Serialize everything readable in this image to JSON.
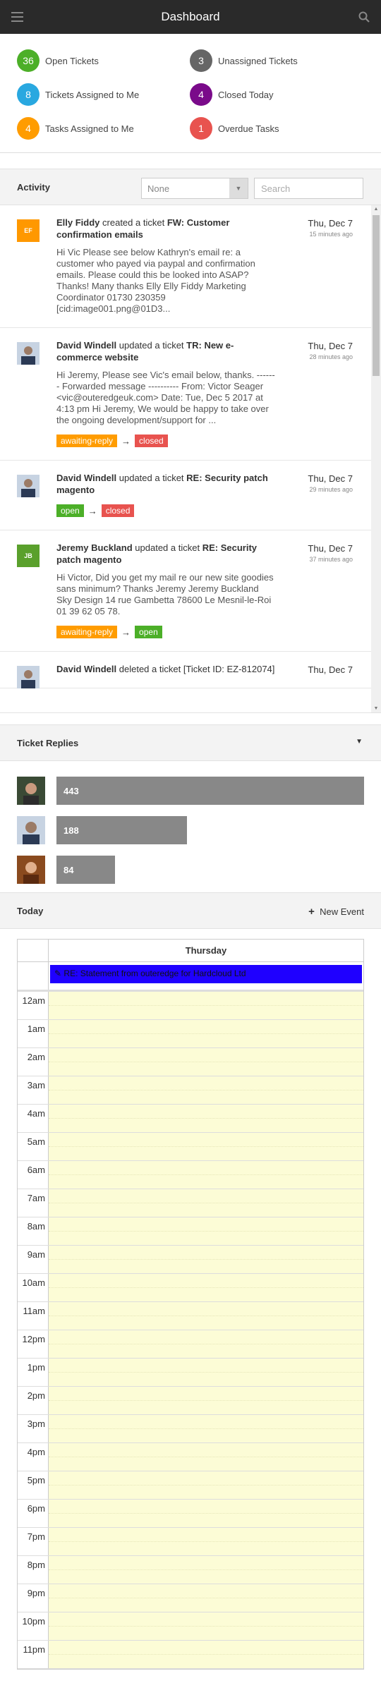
{
  "header": {
    "title": "Dashboard",
    "menu_icon": "hamburger-icon",
    "search_icon": "search-icon"
  },
  "stats": [
    {
      "count": "36",
      "label": "Open Tickets",
      "color": "#4caf28"
    },
    {
      "count": "3",
      "label": "Unassigned Tickets",
      "color": "#666666"
    },
    {
      "count": "8",
      "label": "Tickets Assigned to Me",
      "color": "#29a8e0"
    },
    {
      "count": "4",
      "label": "Closed Today",
      "color": "#7a0a8a"
    },
    {
      "count": "4",
      "label": "Tasks Assigned to Me",
      "color": "#ff9c00"
    },
    {
      "count": "1",
      "label": "Overdue Tasks",
      "color": "#e8534f"
    }
  ],
  "activity": {
    "title": "Activity",
    "filter_value": "None",
    "search_placeholder": "Search",
    "items": [
      {
        "initials": "EF",
        "avatar_color": "#ff9800",
        "actor": "Elly Fiddy",
        "action": "created a ticket",
        "subject": "FW: Customer confirmation emails",
        "date": "Thu, Dec 7",
        "ago": "15 minutes ago",
        "body": "Hi Vic    Please see below Kathryn's email re: a customer who payed via paypal and confirmation emails. Please could this be looked into ASAP? Thanks!    Many thanks  Elly    Elly Fiddy  Marketing Coordinator  01730 230359 [cid:image001.png@01D3..."
      },
      {
        "initials": "",
        "avatar_color": "#6d86a8",
        "actor": "David Windell",
        "action": "updated a ticket",
        "subject": "TR: New e-commerce website",
        "date": "Thu, Dec 7",
        "ago": "28 minutes ago",
        "body": "Hi Jeremy,   Please see Vic's email below, thanks.  ------- Forwarded message ----------     From: Victor Seager <vic@outeredgeuk.com> Date: Tue, Dec 5 2017 at 4:13 pm  Hi Jeremy,  We would be happy to take over the ongoing development/support for ...",
        "tag_from": "awaiting-reply",
        "tag_from_color": "#ff9c00",
        "tag_to": "closed",
        "tag_to_color": "#e8534f"
      },
      {
        "initials": "",
        "avatar_color": "#6d86a8",
        "actor": "David Windell",
        "action": "updated a ticket",
        "subject": "RE: Security patch magento",
        "date": "Thu, Dec 7",
        "ago": "29 minutes ago",
        "tag_from": "open",
        "tag_from_color": "#4caf28",
        "tag_to": "closed",
        "tag_to_color": "#e8534f"
      },
      {
        "initials": "JB",
        "avatar_color": "#5aa02c",
        "actor": "Jeremy Buckland",
        "action": "updated a ticket",
        "subject": "RE: Security patch magento",
        "date": "Thu, Dec 7",
        "ago": "37 minutes ago",
        "body": "Hi Victor,     Did you get my mail re our new site goodies sans minimum? Thanks    Jeremy    Jeremy Buckland         Sky Design     14 rue Gambetta    78600 Le Mesnil-le-Roi         01 39 62 05 78.",
        "tag_from": "awaiting-reply",
        "tag_from_color": "#ff9c00",
        "tag_to": "open",
        "tag_to_color": "#4caf28"
      },
      {
        "initials": "",
        "avatar_color": "#6d86a8",
        "actor": "David Windell",
        "action": "deleted a ticket",
        "subject": "[Ticket ID: EZ-812074]",
        "date": "Thu, Dec 7",
        "ago": ""
      }
    ]
  },
  "ticket_replies": {
    "title": "Ticket Replies",
    "rows": [
      {
        "count": "443",
        "fraction": 1.0
      },
      {
        "count": "188",
        "fraction": 0.4244
      },
      {
        "count": "84",
        "fraction": 0.1896
      }
    ]
  },
  "today": {
    "title": "Today",
    "new_event_label": "New Event",
    "day_name": "Thursday",
    "all_day_event": "RE: Statement from outeredge for Hardcloud Ltd",
    "event_color": "#1f00ff",
    "hours": [
      "12am",
      "1am",
      "2am",
      "3am",
      "4am",
      "5am",
      "6am",
      "7am",
      "8am",
      "9am",
      "10am",
      "11am",
      "12pm",
      "1pm",
      "2pm",
      "3pm",
      "4pm",
      "5pm",
      "6pm",
      "7pm",
      "8pm",
      "9pm",
      "10pm",
      "11pm"
    ]
  }
}
